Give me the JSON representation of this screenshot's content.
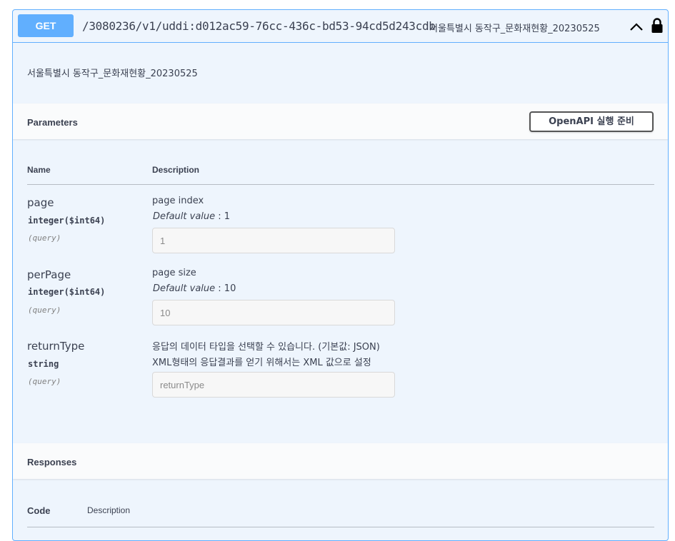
{
  "operation": {
    "method": "GET",
    "path": "/3080236/v1/uddi:d012ac59-76cc-436c-bd53-94cd5d243cdb",
    "summary": "서울특별시 동작구_문화재현황_20230525",
    "description": "서울특별시 동작구_문화재현황_20230525",
    "icons": [
      "chevron-up-icon",
      "lock-icon"
    ],
    "accent_color": "#61affe"
  },
  "parameters": {
    "title": "Parameters",
    "try_button": "OpenAPI 실행 준비",
    "col_name": "Name",
    "col_description": "Description",
    "items": [
      {
        "name": "page",
        "type": "integer($int64)",
        "in": "(query)",
        "description": "page index",
        "default_label": "Default value",
        "default_value": ": 1",
        "input_value": "1"
      },
      {
        "name": "perPage",
        "type": "integer($int64)",
        "in": "(query)",
        "description": "page size",
        "default_label": "Default value",
        "default_value": ": 10",
        "input_value": "10"
      },
      {
        "name": "returnType",
        "type": "string",
        "in": "(query)",
        "description_line1": "응답의 데이터 타입을 선택할 수 있습니다. (기본값: JSON)",
        "description_line2": "XML형태의 응답결과를 얻기 위해서는 XML 값으로 설정",
        "input_placeholder": "returnType"
      }
    ]
  },
  "responses": {
    "title": "Responses",
    "col_code": "Code",
    "col_description": "Description"
  }
}
